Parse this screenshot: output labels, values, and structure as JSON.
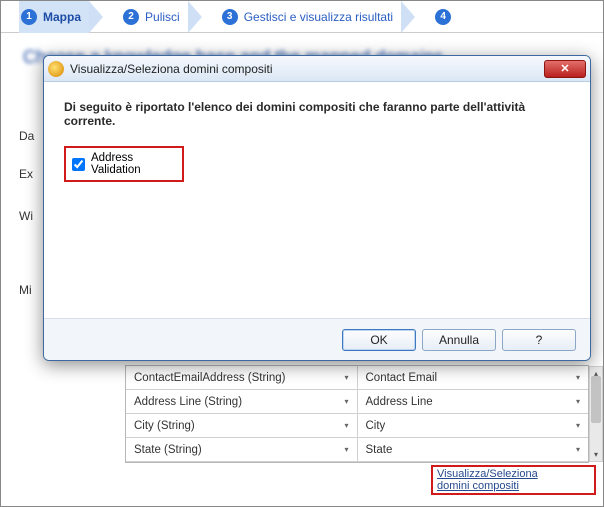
{
  "wizard": {
    "steps": [
      {
        "num": "1",
        "label": "Mappa"
      },
      {
        "num": "2",
        "label": "Pulisci"
      },
      {
        "num": "3",
        "label": "Gestisci e visualizza risultati"
      },
      {
        "num": "4",
        "label": ""
      }
    ]
  },
  "page": {
    "title_blurred": "Choose a knowledge base and the mapped domains"
  },
  "left_letters": {
    "d": "Da",
    "e": "Ex",
    "w": "Wi",
    "m": "Mi"
  },
  "table": {
    "rows": [
      {
        "source": "ContactEmailAddress (String)",
        "domain": "Contact Email"
      },
      {
        "source": "Address Line (String)",
        "domain": "Address Line"
      },
      {
        "source": "City (String)",
        "domain": "City"
      },
      {
        "source": "State (String)",
        "domain": "State"
      }
    ]
  },
  "bottom_link": {
    "line1": "Visualizza/Seleziona",
    "line2": "domini compositi"
  },
  "dialog": {
    "title": "Visualizza/Seleziona domini compositi",
    "instruction": "Di seguito è riportato l'elenco dei domini compositi che faranno parte dell'attività corrente.",
    "checkbox_label": "Address Validation",
    "checkbox_checked": true,
    "buttons": {
      "ok": "OK",
      "cancel": "Annulla",
      "help": "?"
    }
  }
}
